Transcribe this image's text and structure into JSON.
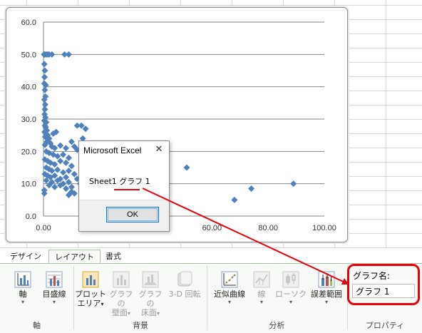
{
  "chart_data": {
    "type": "scatter",
    "xlim": [
      0,
      100
    ],
    "ylim": [
      0,
      60
    ],
    "x_ticks": [
      "0.00",
      "20.00",
      "40.00",
      "60.00",
      "80.00",
      "100.00"
    ],
    "y_ticks": [
      "0.0",
      "10.0",
      "20.0",
      "30.0",
      "40.0",
      "50.0",
      "60.0"
    ],
    "grid": true,
    "marker_color": "#4f81bd",
    "points": [
      [
        0.2,
        50
      ],
      [
        0.5,
        50
      ],
      [
        1,
        50
      ],
      [
        1.5,
        50
      ],
      [
        2,
        50
      ],
      [
        3,
        50
      ],
      [
        7.5,
        50
      ],
      [
        9,
        50
      ],
      [
        0.3,
        47
      ],
      [
        0.5,
        45
      ],
      [
        0.4,
        43
      ],
      [
        0.3,
        41
      ],
      [
        0.8,
        40.5
      ],
      [
        0.5,
        39
      ],
      [
        0.7,
        37
      ],
      [
        0.3,
        36
      ],
      [
        0.6,
        34.5
      ],
      [
        0.5,
        33
      ],
      [
        0.4,
        31.5
      ],
      [
        0.7,
        30.5
      ],
      [
        0.3,
        29.5
      ],
      [
        1.0,
        29
      ],
      [
        0.5,
        28
      ],
      [
        0.8,
        27.5
      ],
      [
        1.2,
        26.5
      ],
      [
        0.4,
        26
      ],
      [
        1.5,
        25
      ],
      [
        0.6,
        24.5
      ],
      [
        2.0,
        24
      ],
      [
        3.5,
        25.5
      ],
      [
        4.5,
        26
      ],
      [
        12,
        28
      ],
      [
        13.5,
        28
      ],
      [
        15,
        27
      ],
      [
        14,
        24
      ],
      [
        10,
        23
      ],
      [
        1.2,
        23
      ],
      [
        2.5,
        22.5
      ],
      [
        0.5,
        22
      ],
      [
        3,
        21.5
      ],
      [
        4,
        21
      ],
      [
        6,
        21.8
      ],
      [
        8,
        21
      ],
      [
        11,
        21.5
      ],
      [
        1,
        20
      ],
      [
        2,
        19.5
      ],
      [
        3.5,
        19
      ],
      [
        5,
        18.5
      ],
      [
        7,
        19
      ],
      [
        9,
        18
      ],
      [
        12,
        20.5
      ],
      [
        0.5,
        17.5
      ],
      [
        1.5,
        17
      ],
      [
        2.5,
        16.5
      ],
      [
        4,
        16
      ],
      [
        6,
        17
      ],
      [
        8,
        16.5
      ],
      [
        10,
        15.5
      ],
      [
        1,
        15
      ],
      [
        2,
        14.5
      ],
      [
        3,
        14
      ],
      [
        5,
        14.3
      ],
      [
        7,
        13.5
      ],
      [
        9,
        14
      ],
      [
        11,
        13
      ],
      [
        0.5,
        13
      ],
      [
        1.5,
        12.5
      ],
      [
        2.5,
        12
      ],
      [
        4,
        12.5
      ],
      [
        6,
        11.5
      ],
      [
        8,
        12
      ],
      [
        12,
        11.5
      ],
      [
        1,
        11
      ],
      [
        3,
        10.5
      ],
      [
        5,
        11
      ],
      [
        7,
        10
      ],
      [
        9,
        10.5
      ],
      [
        13,
        10
      ],
      [
        2,
        9.5
      ],
      [
        4,
        9
      ],
      [
        6,
        9.5
      ],
      [
        8,
        8.5
      ],
      [
        10,
        9
      ],
      [
        14,
        8.5
      ],
      [
        15,
        9.5
      ],
      [
        0.3,
        8
      ],
      [
        0.3,
        7
      ],
      [
        10,
        7.5
      ],
      [
        9,
        6.5
      ],
      [
        11,
        7
      ],
      [
        16,
        11
      ],
      [
        17,
        12.5
      ],
      [
        18,
        11.5
      ],
      [
        19,
        10
      ],
      [
        22,
        12
      ],
      [
        32,
        6.5
      ],
      [
        51,
        15
      ],
      [
        68,
        5
      ],
      [
        74,
        8.5
      ],
      [
        89,
        10
      ]
    ]
  },
  "dialog": {
    "title": "Microsoft Excel",
    "close_glyph": "✕",
    "message": "Sheet1 グラフ 1",
    "ok_label": "OK"
  },
  "ribbon": {
    "tabs": [
      "デザイン",
      "レイアウト",
      "書式"
    ],
    "active_tab": "レイアウト",
    "groups": {
      "axes": {
        "label": "軸",
        "axes_button": "軸",
        "gridlines_button": "目盛線"
      },
      "background": {
        "label": "背景",
        "plot_area_line1": "プロット",
        "plot_area_line2": "エリア",
        "chart_wall_line1": "グラフの",
        "chart_wall_line2": "壁面",
        "chart_floor_line1": "グラフの",
        "chart_floor_line2": "床面",
        "rotation_3d": "3-D 回転"
      },
      "analysis": {
        "label": "分析",
        "trendline": "近似曲線",
        "lines": "線",
        "updown_bars": "ローソク",
        "error_bars": "誤差範囲"
      },
      "properties": {
        "label": "プロパティ",
        "chart_name_label": "グラフ名:",
        "chart_name_value": "グラフ 1"
      }
    },
    "dropdown_glyph": "▾"
  },
  "annotation": {
    "color": "#e8000b"
  }
}
